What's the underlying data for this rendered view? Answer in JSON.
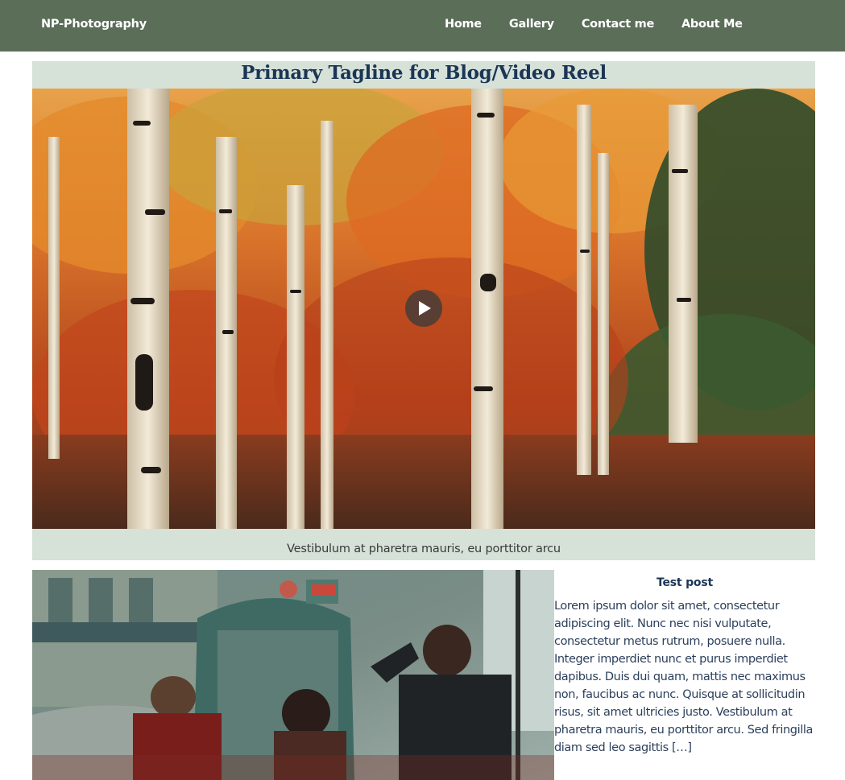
{
  "header": {
    "brand": "NP-Photography",
    "nav": [
      {
        "label": "Home"
      },
      {
        "label": "Gallery"
      },
      {
        "label": "Contact me"
      },
      {
        "label": "About Me"
      }
    ],
    "background_color": "#5b6e58"
  },
  "hero": {
    "tagline": "Primary Tagline for Blog/Video Reel",
    "caption": "Vestibulum at pharetra mauris, eu porttitor arcu",
    "video_icon": "play-icon",
    "background_color": "#d6e1d8"
  },
  "post": {
    "title": "Test post",
    "excerpt": "Lorem ipsum dolor sit amet, consectetur adipiscing elit. Nunc nec nisi vulputate, consectetur metus rutrum, posuere nulla. Integer imperdiet nunc et purus imperdiet dapibus. Duis dui quam, mattis nec maximus non, faucibus ac nunc. Quisque at sollicitudin risus, sit amet ultricies justo. Vestibulum at pharetra mauris, eu porttitor arcu. Sed fringilla diam sed leo sagittis […]"
  },
  "colors": {
    "heading": "#1b3555",
    "body_text": "#2b3f5c"
  }
}
